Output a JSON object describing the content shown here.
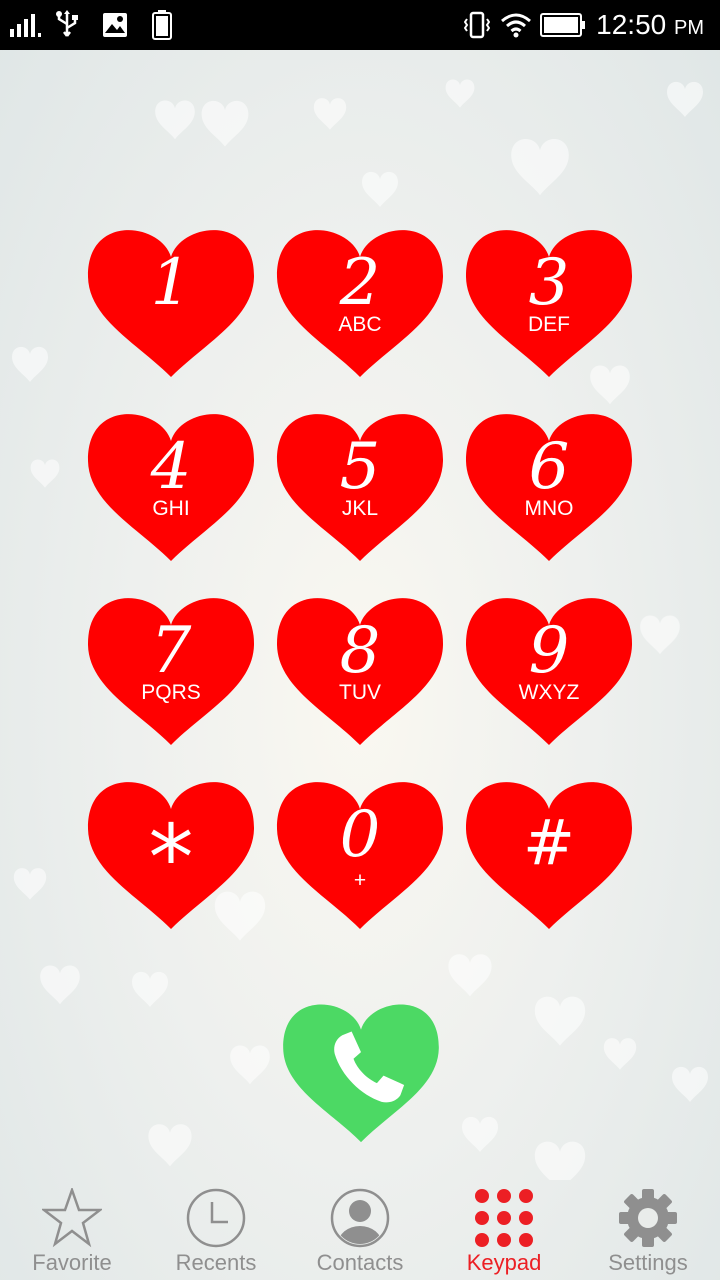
{
  "status_bar": {
    "time": "12:50",
    "ampm": "PM",
    "battery_saver_text": "100"
  },
  "keypad": {
    "keys": [
      {
        "digit": "1",
        "letters": ""
      },
      {
        "digit": "2",
        "letters": "ABC"
      },
      {
        "digit": "3",
        "letters": "DEF"
      },
      {
        "digit": "4",
        "letters": "GHI"
      },
      {
        "digit": "5",
        "letters": "JKL"
      },
      {
        "digit": "6",
        "letters": "MNO"
      },
      {
        "digit": "7",
        "letters": "PQRS"
      },
      {
        "digit": "8",
        "letters": "TUV"
      },
      {
        "digit": "9",
        "letters": "WXYZ"
      },
      {
        "digit": "*",
        "letters": ""
      },
      {
        "digit": "0",
        "letters": "+"
      },
      {
        "digit": "#",
        "letters": ""
      }
    ],
    "key_color": "#ff0000",
    "call_color": "#4cd964"
  },
  "nav": {
    "items": [
      {
        "label": "Favorite",
        "icon": "star-icon",
        "active": false
      },
      {
        "label": "Recents",
        "icon": "clock-icon",
        "active": false
      },
      {
        "label": "Contacts",
        "icon": "contact-icon",
        "active": false
      },
      {
        "label": "Keypad",
        "icon": "keypad-icon",
        "active": true
      },
      {
        "label": "Settings",
        "icon": "gear-icon",
        "active": false
      }
    ],
    "active_color": "#ec1f24",
    "inactive_color": "#8f8f8f"
  }
}
